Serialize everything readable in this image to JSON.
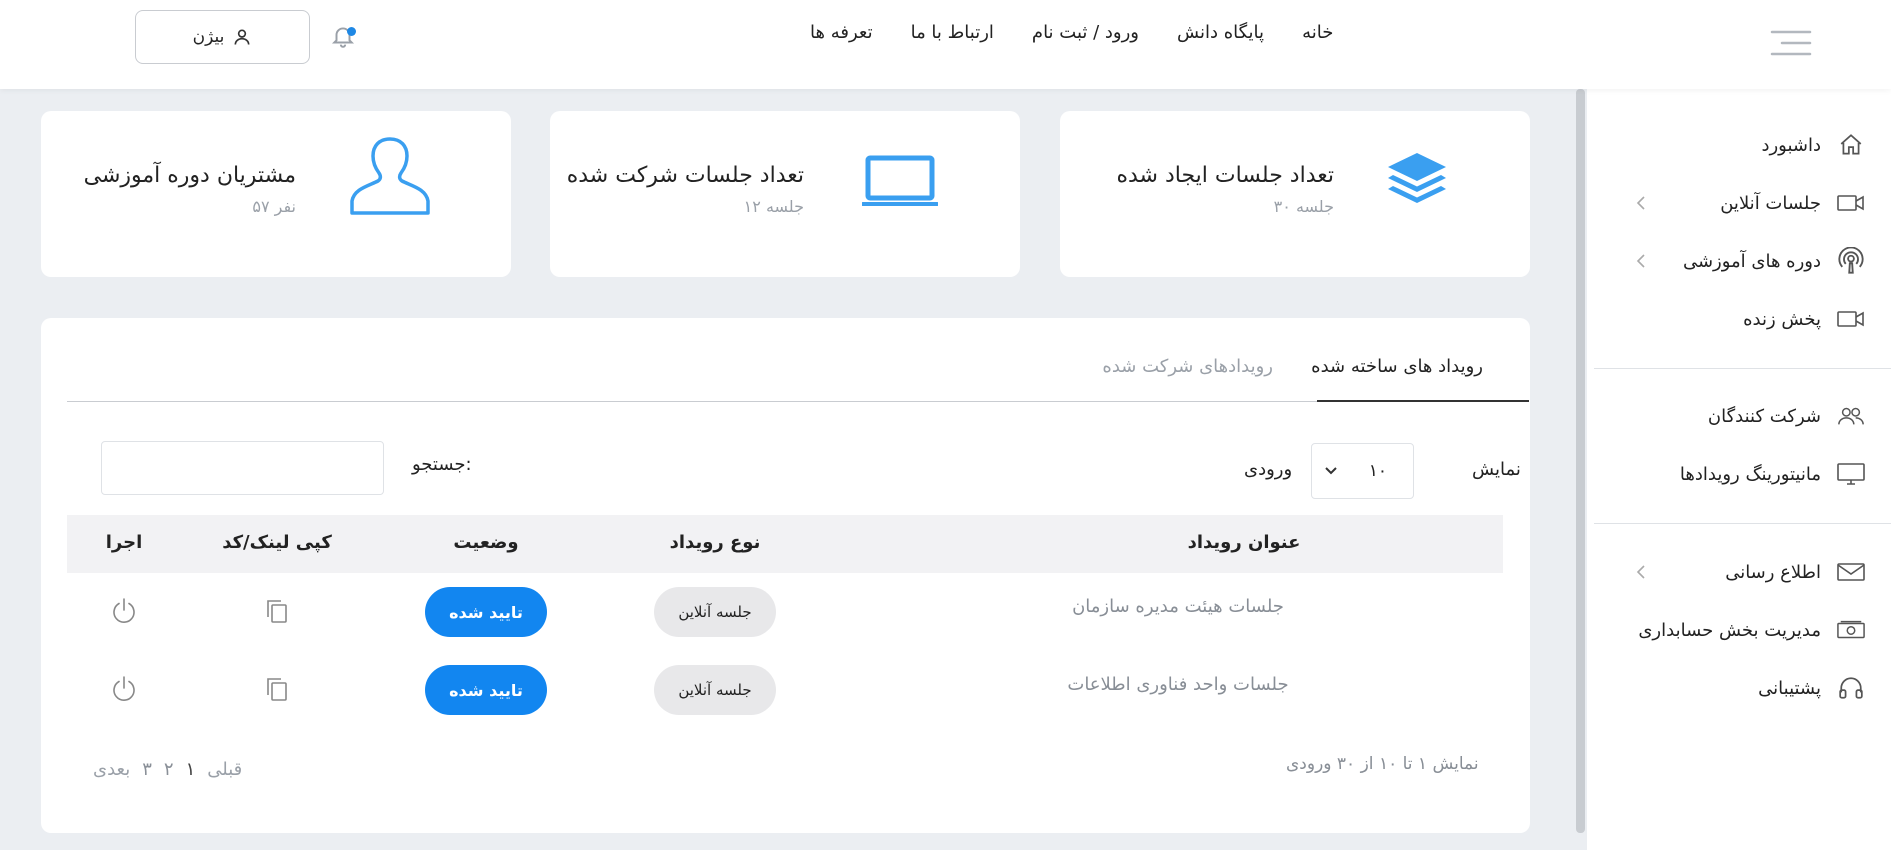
{
  "header": {
    "user_button_label": "بیژن",
    "nav": [
      "خانه",
      "پایگاه دانش",
      "ورود / ثبت نام",
      "ارتباط با ما",
      "تعرفه ها"
    ]
  },
  "sidebar": {
    "items": [
      {
        "label": "داشبورد",
        "icon": "home-icon"
      },
      {
        "label": "جلسات آنلاین",
        "icon": "video-camera-icon"
      },
      {
        "label": "دوره های آموزشی",
        "icon": "podcast-icon"
      },
      {
        "label": "پخش زنده",
        "icon": "video-camera-icon"
      },
      {
        "label": "شرکت کنندگان",
        "icon": "users-icon"
      },
      {
        "label": "مانیتورینگ رویدادها",
        "icon": "monitor-icon"
      },
      {
        "label": "اطلاع رسانی",
        "icon": "envelope-icon"
      },
      {
        "label": "مدیریت بخش حسابداری",
        "icon": "cash-icon"
      },
      {
        "label": "پشتیبانی",
        "icon": "headphones-icon"
      }
    ]
  },
  "cards": [
    {
      "title": "تعداد جلسات ایجاد شده",
      "subtitle": "۳۰ جلسه",
      "icon": "layers-icon"
    },
    {
      "title": "تعداد جلسات شرکت شده",
      "subtitle": "۱۲ جلسه",
      "icon": "laptop-icon"
    },
    {
      "title": "مشتریان دوره آموزشی",
      "subtitle": "۵۷ نفر",
      "icon": "user-icon"
    }
  ],
  "tabs": {
    "active": "رویداد های ساخته شده",
    "inactive": "رویدادهای شرکت شده"
  },
  "table_controls": {
    "show_label": "نمایش",
    "entries_label": "ورودی",
    "page_length": "۱۰",
    "search_label": "جستجو:",
    "search_value": ""
  },
  "table": {
    "headers": {
      "title": "عنوان رویداد",
      "type": "نوع رویداد",
      "status": "وضعیت",
      "copy": "کپی لینک/کد",
      "run": "اجرا"
    },
    "rows": [
      {
        "title": "جلسات هیئت مدیره سازمان",
        "type": "جلسه آنلاین",
        "status": "تایید شده"
      },
      {
        "title": "جلسات واحد فناوری اطلاعات",
        "type": "جلسه آنلاین",
        "status": "تایید شده"
      }
    ]
  },
  "footer": {
    "info": "نمایش ۱ تا ۱۰ از ۳۰ ورودی",
    "prev": "قبلی",
    "pages": [
      "۱",
      "۲",
      "۳"
    ],
    "next": "بعدی"
  },
  "colors": {
    "accent": "#1286f0",
    "icon_blue": "#3a9ff0",
    "background": "#ebeef2"
  }
}
